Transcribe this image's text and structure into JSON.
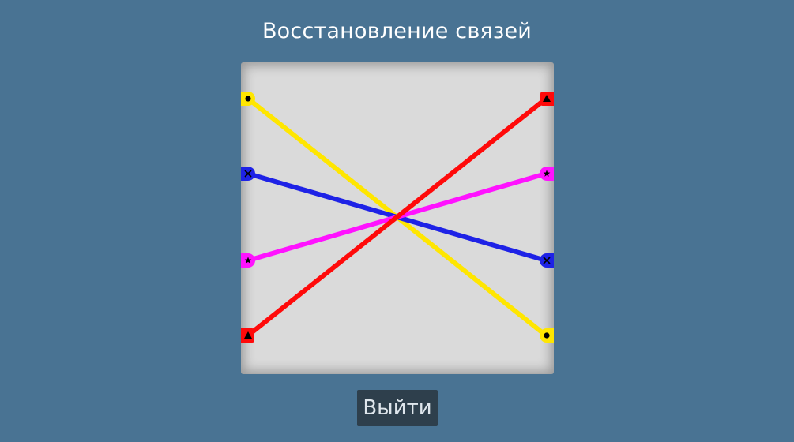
{
  "title": "Восстановление связей",
  "exit_label": "Выйти",
  "colors": {
    "background": "#497393",
    "board": "#dadada",
    "button": "#2e3f4c"
  },
  "links": [
    {
      "color": "#ffe600",
      "symbol": "circle",
      "left_row": 0,
      "right_row": 3
    },
    {
      "color": "#1e22e6",
      "symbol": "cross",
      "left_row": 1,
      "right_row": 2
    },
    {
      "color": "#ff12ff",
      "symbol": "star",
      "left_row": 2,
      "right_row": 1
    },
    {
      "color": "#ff0a0a",
      "symbol": "triangle",
      "left_row": 3,
      "right_row": 0
    }
  ]
}
